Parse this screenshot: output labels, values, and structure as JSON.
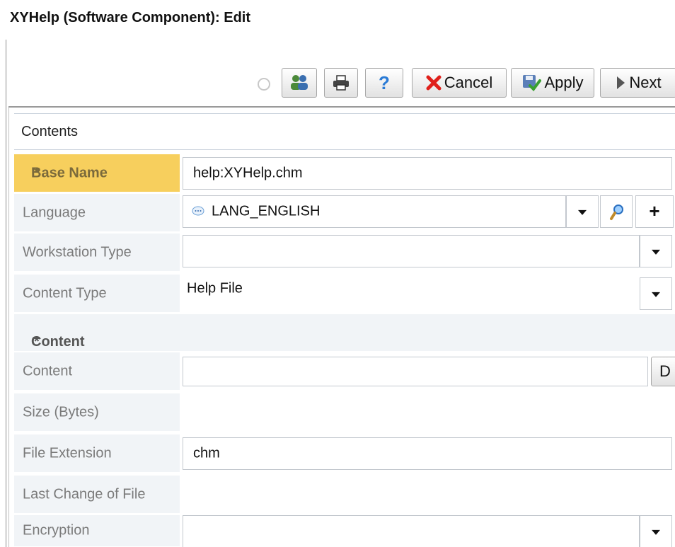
{
  "window": {
    "title": "XYHelp (Software Component): Edit"
  },
  "toolbar": {
    "cancel_label": "Cancel",
    "apply_label": "Apply",
    "next_label": "Next",
    "help_glyph": "?",
    "icons": [
      "refresh-icon",
      "group-icon",
      "print-icon",
      "help-icon",
      "cancel-x-icon",
      "apply-save-icon",
      "next-arrow-icon"
    ]
  },
  "section": {
    "title": "Contents"
  },
  "fields": {
    "base_name": {
      "label": "Base Name",
      "required_mark": "*",
      "value": "help:XYHelp.chm"
    },
    "language": {
      "label": "Language",
      "value": "LANG_ENGLISH",
      "add_glyph": "+"
    },
    "workstation_type": {
      "label": "Workstation Type",
      "value": ""
    },
    "content_type": {
      "label": "Content Type",
      "value": "Help File"
    },
    "content_group": {
      "label": "Content",
      "required_mark": "*"
    },
    "content": {
      "label": "Content",
      "value": "",
      "button_glyph": "D"
    },
    "size": {
      "label": "Size (Bytes)",
      "value": ""
    },
    "file_extension": {
      "label": "File Extension",
      "value": "chm"
    },
    "last_change": {
      "label": "Last Change of File",
      "value": ""
    },
    "encryption": {
      "label": "Encryption",
      "value": ""
    }
  },
  "colors": {
    "required_label_bg": "#f7cf5d",
    "required_star": "#d8302c",
    "label_bg": "#f1f4f7",
    "cancel_x": "#e0201b",
    "help_blue": "#2a7bd6"
  }
}
